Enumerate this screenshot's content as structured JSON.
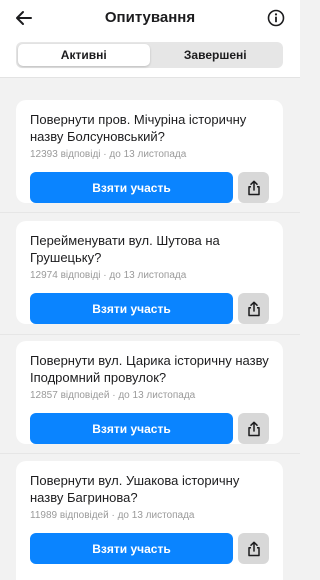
{
  "header": {
    "title": "Опитування",
    "back_icon": "arrow-left-icon",
    "info_icon": "info-icon"
  },
  "tabs": [
    {
      "label": "Активні",
      "active": true
    },
    {
      "label": "Завершені",
      "active": false
    }
  ],
  "polls": [
    {
      "title": "Повернути пров. Мічуріна історичну назву Болсуновський?",
      "meta": "12393 відповіді · до 13 листопада",
      "action_label": "Взяти участь"
    },
    {
      "title": "Перейменувати вул. Шутова на Грушецьку?",
      "meta": "12974 відповіді · до 13 листопада",
      "action_label": "Взяти участь"
    },
    {
      "title": "Повернути вул. Царика історичну назву Іподромний провулок?",
      "meta": "12857 відповідей · до 13 листопада",
      "action_label": "Взяти участь"
    },
    {
      "title": "Повернути вул. Ушакова історичну назву Багринова?",
      "meta": "11989 відповідей · до 13 листопада",
      "action_label": "Взяти участь"
    }
  ],
  "colors": {
    "accent": "#0a84ff",
    "background": "#f2f2f2",
    "card": "#ffffff",
    "share_button": "#d8d8d8",
    "meta_text": "#9a9a9a"
  }
}
